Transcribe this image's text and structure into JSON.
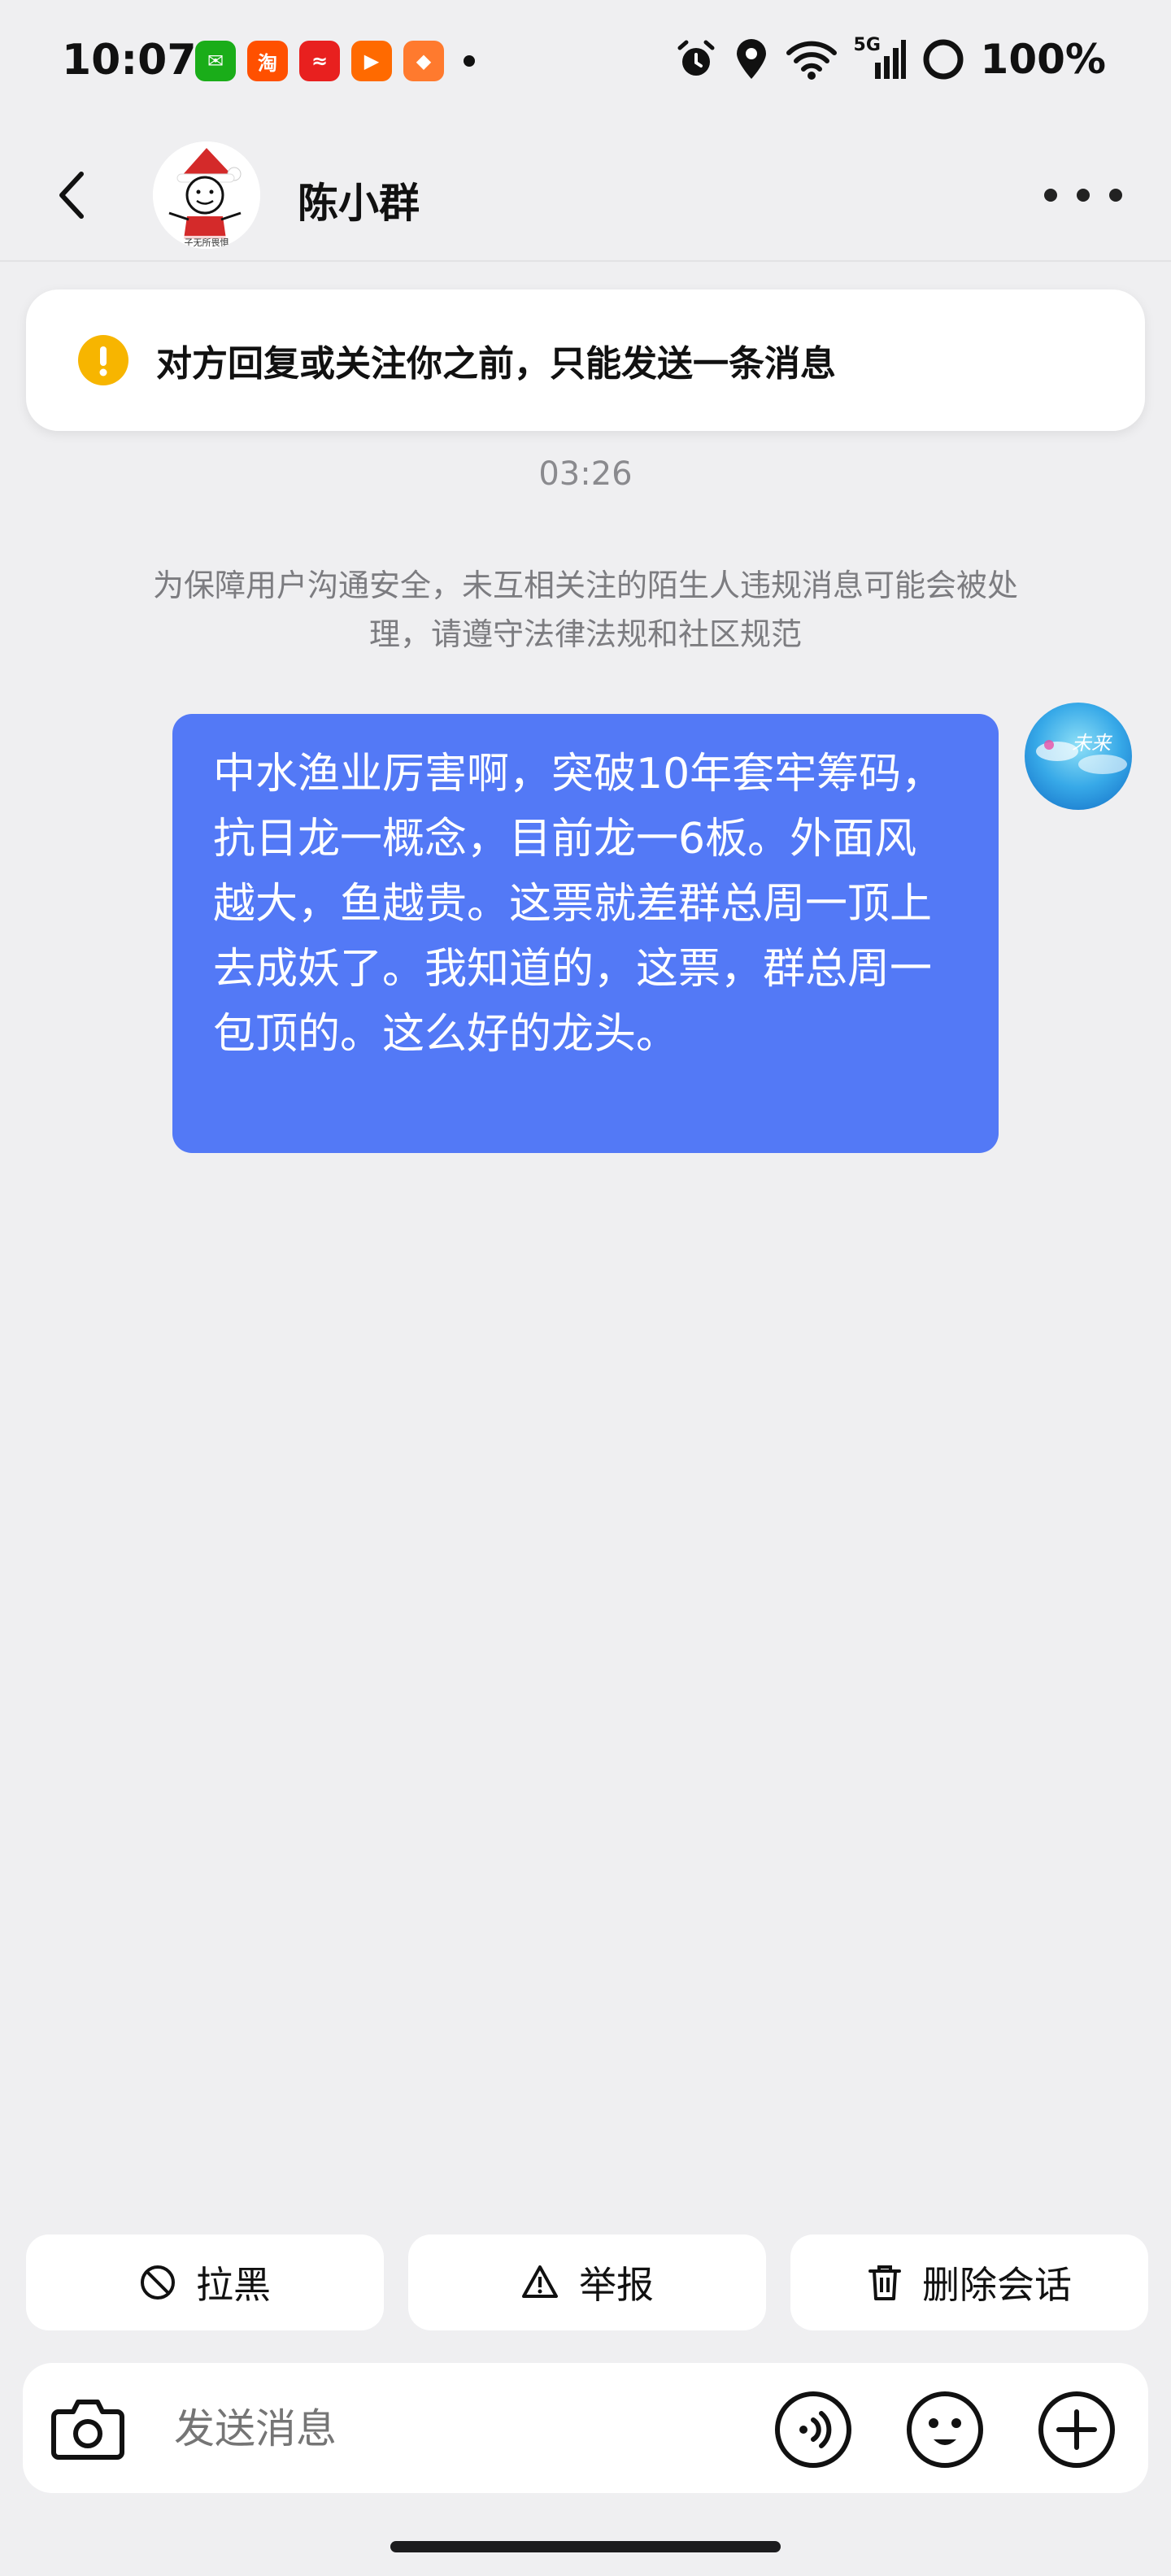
{
  "status_bar": {
    "time": "10:07",
    "network": "5G",
    "battery": "100%",
    "apps": [
      {
        "icon": "wechat-icon",
        "color": "#1aad19",
        "glyph": "✉"
      },
      {
        "icon": "taobao-icon",
        "color": "#ff5000",
        "glyph": "淘"
      },
      {
        "icon": "app-red-icon",
        "color": "#e8201f",
        "glyph": "≈"
      },
      {
        "icon": "kuaishou-icon",
        "color": "#ff6a00",
        "glyph": "▶"
      },
      {
        "icon": "game-icon",
        "color": "#ff7a2e",
        "glyph": "◆"
      }
    ]
  },
  "header": {
    "title": "陈小群",
    "avatar_caption": "子无所畏惧"
  },
  "notice": {
    "text": "对方回复或关注你之前，只能发送一条消息"
  },
  "chat": {
    "timestamp": "03:26",
    "safety_notice": "为保障用户沟通安全，未互相关注的陌生人违规消息可能会被处理，请遵守法律法规和社区规范",
    "message": "中水渔业厉害啊，突破10年套牢筹码，抗日龙一概念，目前龙一6板。外面风越大，鱼越贵。这票就差群总周一顶上去成妖了。我知道的，这票，群总周一包顶的。这么好的龙头。",
    "my_avatar_text": "未来"
  },
  "actions": {
    "block": "拉黑",
    "report": "举报",
    "delete": "删除会话"
  },
  "input": {
    "placeholder": "发送消息"
  },
  "colors": {
    "bubble": "#5379f6",
    "warning": "#f7b500",
    "background": "#efeff1"
  }
}
